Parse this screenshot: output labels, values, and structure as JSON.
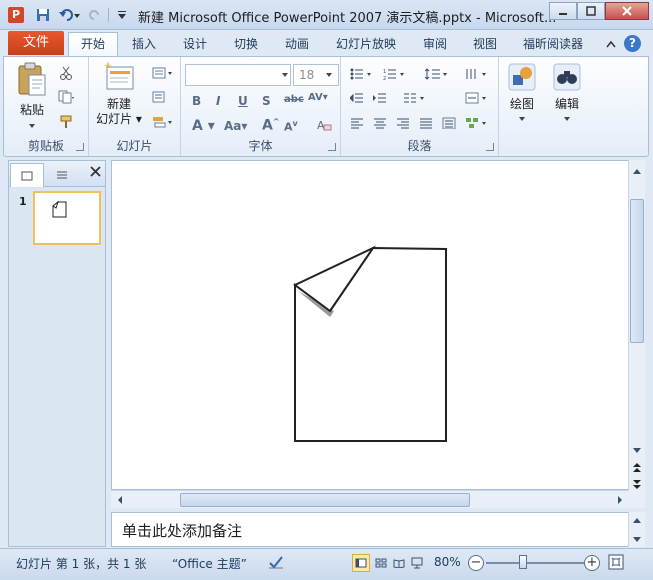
{
  "window": {
    "app_icon_letter": "P",
    "title": "新建 Microsoft Office PowerPoint 2007 演示文稿.pptx - Microsoft..."
  },
  "tabs": {
    "file": "文件",
    "items": [
      "开始",
      "插入",
      "设计",
      "切换",
      "动画",
      "幻灯片放映",
      "审阅",
      "视图",
      "福昕阅读器"
    ],
    "active": "开始"
  },
  "ribbon": {
    "clipboard": {
      "label": "剪贴板",
      "paste": "粘贴"
    },
    "slides": {
      "label": "幻灯片",
      "new_slide_line1": "新建",
      "new_slide_line2": "幻灯片"
    },
    "font": {
      "label": "字体",
      "font_name": "",
      "font_size": "18"
    },
    "paragraph": {
      "label": "段落"
    },
    "drawing": {
      "label": "绘图"
    },
    "editing": {
      "label": "编辑"
    }
  },
  "slides_pane": {
    "slide_number": "1"
  },
  "notes": {
    "placeholder": "单击此处添加备注"
  },
  "statusbar": {
    "slide_info": "幻灯片 第 1 张，共 1 张",
    "theme": "“Office 主题”",
    "zoom": "80%"
  },
  "colors": {
    "file_tab": "#d24726",
    "ribbon_bg": "#e4edf8",
    "selected_thumb_border": "#f0c15a"
  }
}
